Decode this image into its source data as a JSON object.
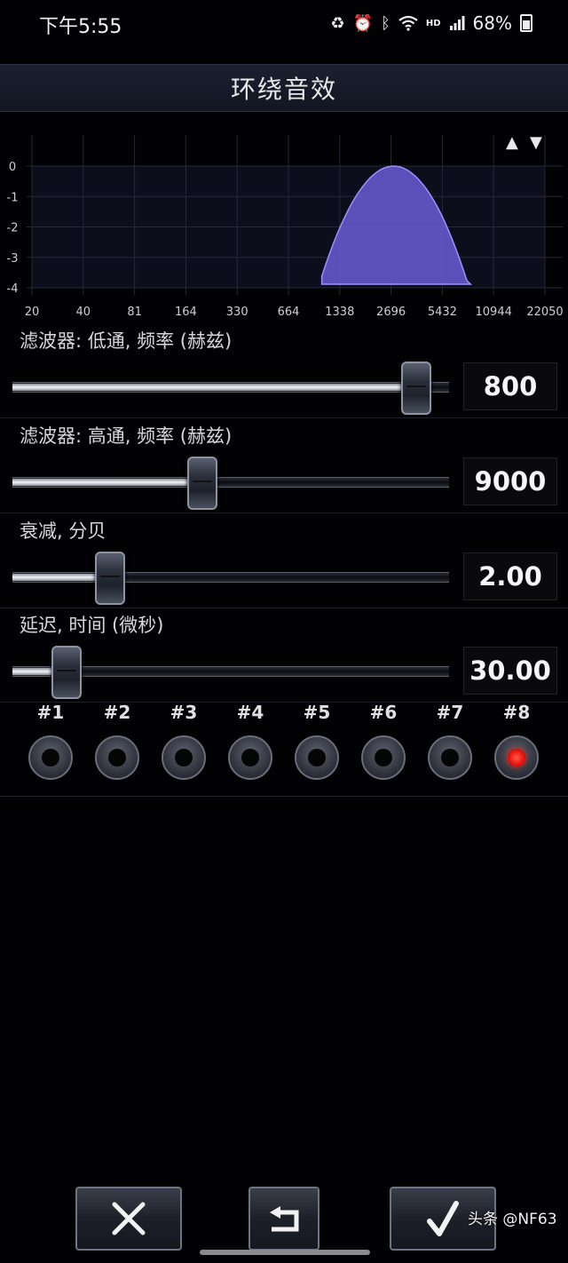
{
  "status_bar": {
    "time": "下午5:55",
    "network": "HD",
    "battery": "68%"
  },
  "title": "环绕音效",
  "graph": {
    "y_ticks": [
      "0",
      "-1",
      "-2",
      "-3",
      "-4"
    ],
    "x_ticks": [
      "20",
      "40",
      "81",
      "164",
      "330",
      "664",
      "1338",
      "2696",
      "5432",
      "10944",
      "22050"
    ],
    "up_label": "▲",
    "down_label": "▼",
    "curve_color": "#6a5ad6"
  },
  "sliders": [
    {
      "label": "滤波器: 低通, 频率 (赫兹)",
      "value": "800",
      "fraction": 0.92
    },
    {
      "label": "滤波器: 高通, 频率 (赫兹)",
      "value": "9000",
      "fraction": 0.43
    },
    {
      "label": "衰减, 分贝",
      "value": "2.00",
      "fraction": 0.22
    },
    {
      "label": "延迟, 时间 (微秒)",
      "value": "30.00",
      "fraction": 0.12
    }
  ],
  "presets": [
    {
      "label": "#1",
      "active": false
    },
    {
      "label": "#2",
      "active": false
    },
    {
      "label": "#3",
      "active": false
    },
    {
      "label": "#4",
      "active": false
    },
    {
      "label": "#5",
      "active": false
    },
    {
      "label": "#6",
      "active": false
    },
    {
      "label": "#7",
      "active": false
    },
    {
      "label": "#8",
      "active": true
    }
  ],
  "buttons": {
    "cancel": "close-icon",
    "reset": "undo-icon",
    "confirm": "check-icon"
  },
  "watermark": "头条 @NF63"
}
